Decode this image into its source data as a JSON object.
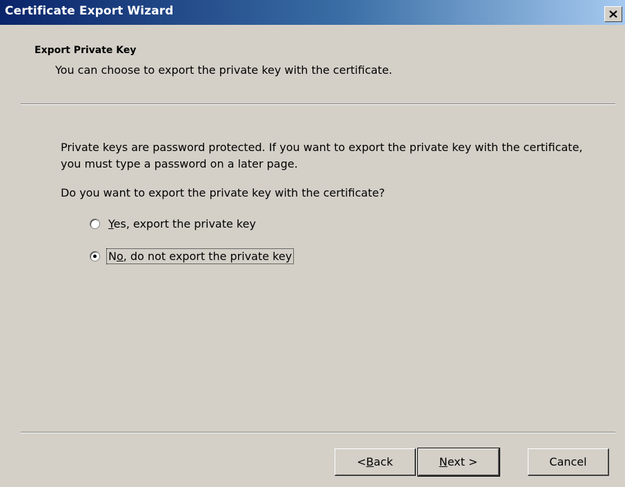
{
  "window": {
    "title": "Certificate Export Wizard",
    "close_icon": "close-icon"
  },
  "header": {
    "title": "Export Private Key",
    "subtitle": "You can choose to export the private key with the certificate."
  },
  "content": {
    "description": "Private keys are password protected. If you want to export the private key with the certificate, you must type a password on a later page.",
    "question": "Do you want to export the private key with the certificate?",
    "options": [
      {
        "label_mnemonic": "Y",
        "label_rest": "es, export the private key",
        "selected": false
      },
      {
        "label_pre": "N",
        "label_mnemonic": "o",
        "label_rest": ", do not export the private key",
        "selected": true
      }
    ]
  },
  "buttons": {
    "back_pre": "< ",
    "back_mnemonic": "B",
    "back_rest": "ack",
    "next_mnemonic": "N",
    "next_rest": "ext >",
    "cancel": "Cancel"
  },
  "colors": {
    "dialog_bg": "#d4d0c8",
    "title_start": "#0a246a",
    "title_end": "#a6caf0"
  }
}
